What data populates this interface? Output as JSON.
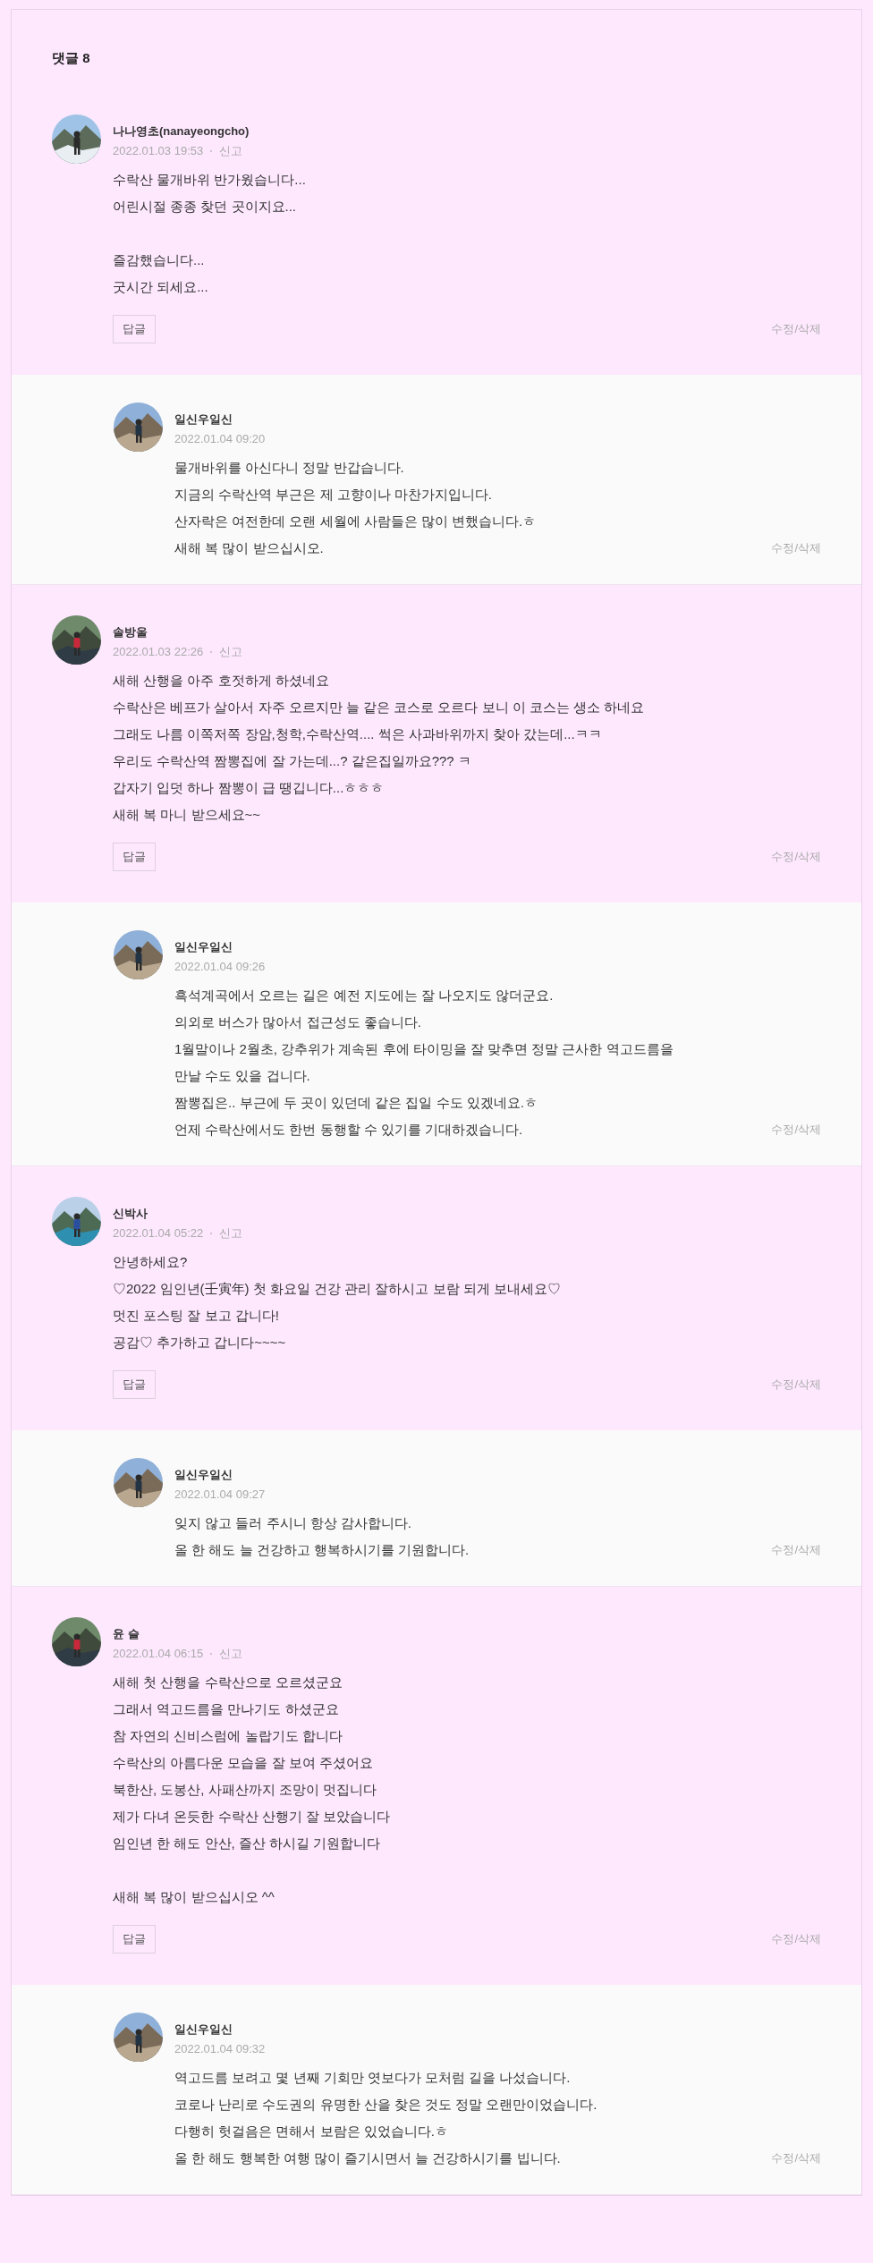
{
  "title": "댓글 8",
  "comments": [
    {
      "author": "나나영초(nanayeongcho)",
      "date": "2022.01.03 19:53",
      "report": "신고",
      "text": "수락산 물개바위 반가웠습니다...\n어린시절 종종 찾던 곳이지요...\n\n즐감했습니다...\n굿시간 되세요...",
      "reply_button": "답글",
      "actions": "수정/삭제",
      "replies": [
        {
          "author": "일신우일신",
          "date": "2022.01.04 09:20",
          "text": "물개바위를 아신다니 정말 반갑습니다.\n지금의 수락산역 부근은 제 고향이나 마찬가지입니다.\n산자락은 여전한데 오랜 세월에 사람들은 많이 변했습니다.ㅎ\n새해 복 많이 받으십시오.",
          "actions": "수정/삭제"
        }
      ]
    },
    {
      "author": "솔방울",
      "date": "2022.01.03 22:26",
      "report": "신고",
      "text": "새해 산행을 아주 호젓하게 하셨네요\n수락산은 베프가 살아서 자주 오르지만 늘 같은 코스로 오르다 보니 이 코스는 생소 하네요\n그래도 나름 이쪽저쪽 장암,청학,수락산역.... 썩은 사과바위까지 찾아 갔는데...ㅋㅋ\n우리도 수락산역 짬뽕집에 잘 가는데...? 같은집일까요??? ㅋ\n갑자기 입덧 하나 짬뽕이 급 땡깁니다...ㅎㅎㅎ\n새해 복 마니 받으세요~~",
      "reply_button": "답글",
      "actions": "수정/삭제",
      "replies": [
        {
          "author": "일신우일신",
          "date": "2022.01.04 09:26",
          "text": "흑석계곡에서 오르는 길은 예전 지도에는 잘 나오지도 않더군요.\n의외로 버스가 많아서 접근성도 좋습니다.\n1월말이나 2월초, 강추위가 계속된 후에 타이밍을 잘 맞추면 정말 근사한 역고드름을\n만날 수도 있을 겁니다.\n짬뽕집은.. 부근에 두 곳이 있던데 같은 집일 수도 있겠네요.ㅎ\n언제 수락산에서도 한번 동행할 수 있기를 기대하겠습니다.",
          "actions": "수정/삭제"
        }
      ]
    },
    {
      "author": "신박사",
      "date": "2022.01.04 05:22",
      "report": "신고",
      "text": "안녕하세요?\n♡2022 임인년(壬寅年) 첫 화요일 건강 관리 잘하시고 보람 되게 보내세요♡\n멋진 포스팅 잘 보고 갑니다!\n공감♡ 추가하고 갑니다~~~~",
      "reply_button": "답글",
      "actions": "수정/삭제",
      "replies": [
        {
          "author": "일신우일신",
          "date": "2022.01.04 09:27",
          "text": "잊지 않고 들러 주시니 항상 감사합니다.\n올 한 해도 늘 건강하고 행복하시기를 기원합니다.",
          "actions": "수정/삭제"
        }
      ]
    },
    {
      "author": "윤 슬",
      "date": "2022.01.04 06:15",
      "report": "신고",
      "text": "새해 첫 산행을 수락산으로 오르셨군요\n그래서 역고드름을 만나기도 하셨군요\n참 자연의 신비스럼에 놀랍기도 합니다\n수락산의 아름다운 모습을 잘 보여 주셨어요\n북한산, 도봉산, 사패산까지 조망이 멋집니다\n제가 다녀 온듯한 수락산 산행기 잘 보았습니다\n임인년 한 해도 안산, 즐산 하시길 기원합니다\n\n새해 복 많이 받으십시오 ^^",
      "reply_button": "답글",
      "actions": "수정/삭제",
      "replies": [
        {
          "author": "일신우일신",
          "date": "2022.01.04 09:32",
          "text": "역고드름 보려고 몇 년째 기회만 엿보다가 모처럼 길을 나섰습니다.\n코로나 난리로 수도권의 유명한 산을 찾은 것도 정말 오랜만이었습니다.\n다행히 헛걸음은 면해서 보람은 있었습니다.ㅎ\n올 한 해도 행복한 여행 많이 즐기시면서 늘 건강하시기를 빕니다.",
          "actions": "수정/삭제"
        }
      ]
    }
  ]
}
